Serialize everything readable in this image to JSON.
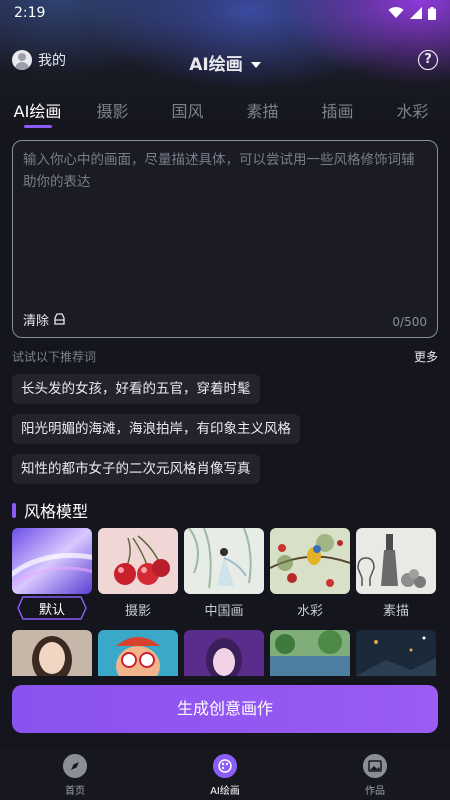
{
  "status": {
    "time": "2:19"
  },
  "header": {
    "me_label": "我的",
    "title": "AI绘画"
  },
  "tabs": [
    {
      "label": "AI绘画",
      "active": true
    },
    {
      "label": "摄影"
    },
    {
      "label": "国风"
    },
    {
      "label": "素描"
    },
    {
      "label": "插画"
    },
    {
      "label": "水彩"
    }
  ],
  "prompt": {
    "placeholder": "输入你心中的画面，尽量描述具体，可以尝试用一些风格修饰词辅助你的表达",
    "clear_label": "清除",
    "counter": "0/500"
  },
  "recommend": {
    "heading": "试试以下推荐词",
    "more": "更多",
    "items": [
      "长头发的女孩，好看的五官，穿着时髦",
      "阳光明媚的海滩，海浪拍岸，有印象主义风格",
      "知性的都市女子的二次元风格肖像写真"
    ]
  },
  "style_section": {
    "title": "风格模型",
    "styles": [
      {
        "label": "默认",
        "selected": true
      },
      {
        "label": "摄影"
      },
      {
        "label": "中国画"
      },
      {
        "label": "水彩"
      },
      {
        "label": "素描"
      }
    ]
  },
  "generate_button": "生成创意画作",
  "nav": [
    {
      "label": "首页",
      "icon": "compass-icon"
    },
    {
      "label": "AI绘画",
      "icon": "palette-icon",
      "active": true
    },
    {
      "label": "作品",
      "icon": "image-icon"
    }
  ],
  "colors": {
    "accent": "#8b5cf6",
    "background": "#15161d"
  }
}
